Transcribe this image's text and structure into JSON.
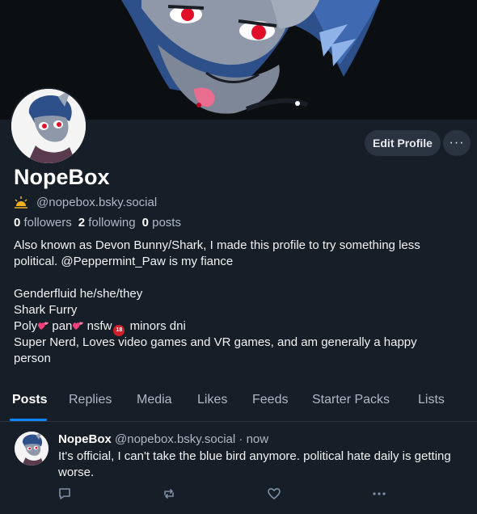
{
  "profile": {
    "display_name": "NopeBox",
    "handle": "@nopebox.bsky.social",
    "followers_count": "0",
    "followers_label": "followers",
    "following_count": "2",
    "following_label": "following",
    "posts_count": "0",
    "posts_label": "posts",
    "bio": {
      "line1": "Also known as Devon Bunny/Shark, I made this profile to try something less",
      "line2": "political. @Peppermint_Paw is my fiance",
      "line3": "Genderfluid he/she/they",
      "line4": "Shark Furry",
      "poly": "Poly",
      "pan": "pan",
      "nsfw": "nsfw",
      "nosign_label": "18",
      "minors": "minors dni",
      "line6": "Super Nerd, Loves video games and VR games, and am generally a happy",
      "line7": "person"
    }
  },
  "actions": {
    "edit_profile": "Edit Profile",
    "more": "···"
  },
  "tabs": [
    "Posts",
    "Replies",
    "Media",
    "Likes",
    "Feeds",
    "Starter Packs",
    "Lists"
  ],
  "active_tab": "Posts",
  "post": {
    "author": "NopeBox",
    "handle": "@nopebox.bsky.social",
    "separator": "·",
    "time": "now",
    "text": "It's official, I can't take the blue bird anymore. political hate daily is getting worse."
  },
  "icons": {
    "reply": "reply-icon",
    "repost": "repost-icon",
    "like": "like-icon",
    "more": "more-icon"
  },
  "colors": {
    "background": "#161e27",
    "accent": "#1083fe",
    "muted_text": "#aeb9c5",
    "button_bg": "#2a3440"
  }
}
